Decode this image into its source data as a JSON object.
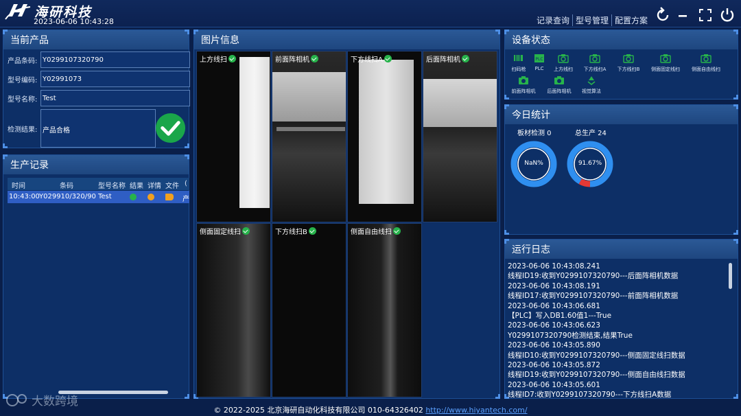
{
  "header": {
    "company": "海研科技",
    "datetime": "2023-06-06 10:43:28",
    "nav": [
      "记录查询",
      "型号管理",
      "配置方案"
    ]
  },
  "product": {
    "title": "当前产品",
    "barcode_label": "产品条码:",
    "barcode_value": "Y0299107320790",
    "model_code_label": "型号编码:",
    "model_code_value": "Y02991073",
    "model_name_label": "型号名称:",
    "model_name_value": "Test",
    "result_label": "检测结果:",
    "result_value": "产品合格"
  },
  "records": {
    "title": "生产记录",
    "columns": [
      "时间",
      "条码",
      "型号名称",
      "结果",
      "详情",
      "文件",
      "("
    ],
    "rows": [
      {
        "time": "10:43:00",
        "barcode": "Y029910/320/90",
        "model": "Test",
        "extra": "产"
      }
    ]
  },
  "images": {
    "title": "图片信息",
    "cells": [
      {
        "label": "上方线扫"
      },
      {
        "label": "前面阵相机"
      },
      {
        "label": "下方线扫A"
      },
      {
        "label": "后面阵相机"
      },
      {
        "label": "侧面固定线扫"
      },
      {
        "label": "下方线扫B"
      },
      {
        "label": "侧面自由线扫"
      }
    ]
  },
  "devices": {
    "title": "设备状态",
    "items": [
      {
        "label": "扫码枪",
        "icon": "barcode-scanner-icon"
      },
      {
        "label": "PLC",
        "icon": "plc-icon"
      },
      {
        "label": "上方线扫",
        "icon": "camera-icon"
      },
      {
        "label": "下方线扫A",
        "icon": "camera-icon"
      },
      {
        "label": "下方线扫B",
        "icon": "camera-icon"
      },
      {
        "label": "侧面固定线扫",
        "icon": "camera-icon"
      },
      {
        "label": "侧面自由线扫",
        "icon": "camera-icon"
      },
      {
        "label": "前面阵相机",
        "icon": "camera-icon"
      },
      {
        "label": "后面阵相机",
        "icon": "camera-icon"
      },
      {
        "label": "视觉算法",
        "icon": "recycle-icon"
      }
    ],
    "active_color": "#27b34b"
  },
  "stats": {
    "title": "今日统计",
    "board_label": "板材检测 0",
    "total_label": "总生产 24",
    "board_percent_text": "NaN%",
    "total_percent_text": "91.67%",
    "total_pass_fraction": 0.9167,
    "ring_color": "#2f8ff0",
    "fail_color": "#e53935"
  },
  "log": {
    "title": "运行日志",
    "lines": [
      "2023-06-06 10:43:08.241",
      "线程ID19:收到Y0299107320790---后面阵相机数据",
      "2023-06-06 10:43:08.191",
      "线程ID17:收到Y0299107320790---前面阵相机数据",
      "2023-06-06 10:43:06.681",
      "【PLC】写入DB1.60值1---True",
      "2023-06-06 10:43:06.623",
      "Y0299107320790检测结束,结果True",
      "2023-06-06 10:43:05.890",
      "线程ID10:收到Y0299107320790---侧面固定线扫数据",
      "2023-06-06 10:43:05.872",
      "线程ID19:收到Y0299107320790---侧面自由线扫数据",
      "2023-06-06 10:43:05.601",
      "线程ID7:收到Y0299107320790---下方线扫A数据"
    ]
  },
  "footer": {
    "copyright": "© 2022-2025 北京海研自动化科技有限公司 010-64326402",
    "link": "http://www.hiyantech.com/"
  },
  "watermark": "大数跨境"
}
